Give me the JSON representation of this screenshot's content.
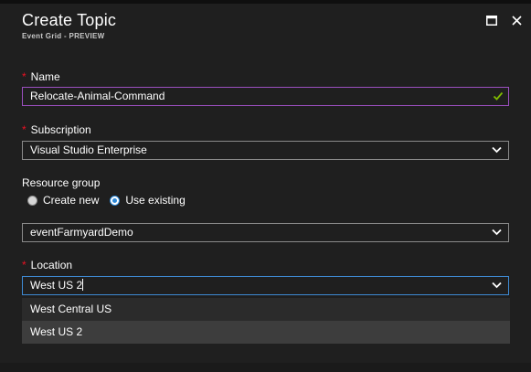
{
  "header": {
    "title": "Create Topic",
    "subtitle": "Event Grid - PREVIEW"
  },
  "form": {
    "required_marker": "*",
    "name": {
      "label": "Name",
      "value": "Relocate-Animal-Command",
      "valid": true
    },
    "subscription": {
      "label": "Subscription",
      "value": "Visual Studio Enterprise"
    },
    "resource_group": {
      "label": "Resource group",
      "options": [
        "Create new",
        "Use existing"
      ],
      "selected": "Use existing",
      "value": "eventFarmyardDemo"
    },
    "location": {
      "label": "Location",
      "value": "West US 2",
      "dropdown_options": [
        "West Central US",
        "West US 2"
      ],
      "highlighted_option": "West US 2"
    }
  },
  "colors": {
    "background": "#1f1f1f",
    "required": "#e81123",
    "valid_border": "#9b4fbf",
    "focus_border": "#3e8ad3",
    "check": "#7fba00"
  },
  "icons": {
    "maximize": "maximize-icon",
    "close": "close-icon",
    "check": "check-icon",
    "chevron": "chevron-down-icon"
  }
}
